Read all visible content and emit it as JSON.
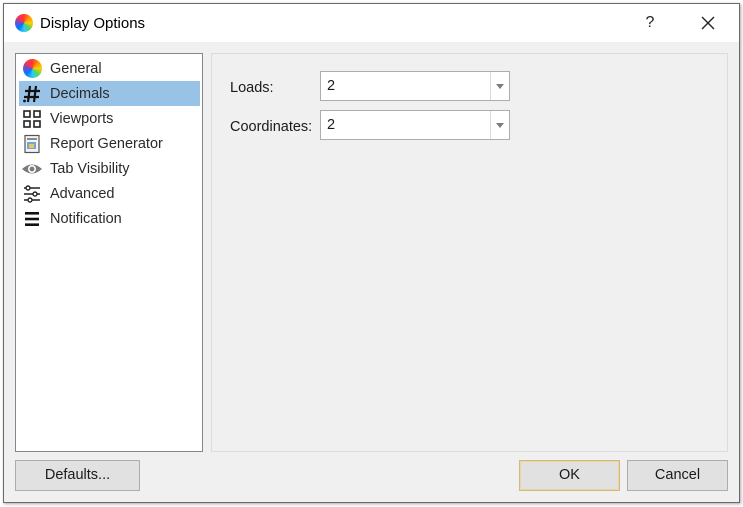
{
  "window": {
    "title": "Display Options",
    "help_label": "?"
  },
  "nav": {
    "items": [
      {
        "label": "General",
        "icon": "color-wheel-icon",
        "selected": false
      },
      {
        "label": "Decimals",
        "icon": "hash-icon",
        "selected": true
      },
      {
        "label": "Viewports",
        "icon": "viewports-grid-icon",
        "selected": false
      },
      {
        "label": "Report Generator",
        "icon": "report-icon",
        "selected": false
      },
      {
        "label": "Tab Visibility",
        "icon": "eye-icon",
        "selected": false
      },
      {
        "label": "Advanced",
        "icon": "sliders-icon",
        "selected": false
      },
      {
        "label": "Notification",
        "icon": "menu-lines-icon",
        "selected": false
      }
    ]
  },
  "decimals": {
    "loads_label": "Loads:",
    "loads_value": "2",
    "coordinates_label": "Coordinates:",
    "coordinates_value": "2"
  },
  "buttons": {
    "defaults": "Defaults...",
    "ok": "OK",
    "cancel": "Cancel"
  },
  "colors": {
    "selection": "#99c3e6",
    "window_bg": "#f0f0f0",
    "default_button_border": "#d4b978"
  }
}
